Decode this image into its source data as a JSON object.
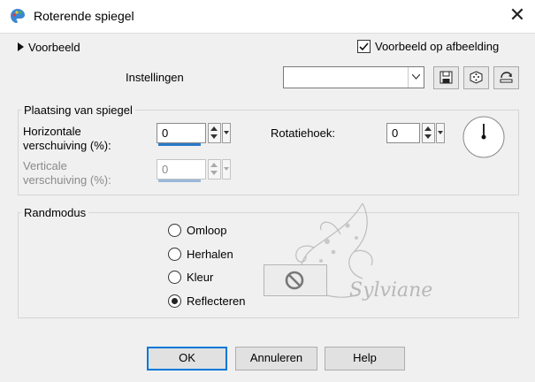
{
  "dialog": {
    "title": "Roterende spiegel",
    "close_glyph": "✕",
    "app_icon": "paint-palette-icon"
  },
  "preview": {
    "label": "Voorbeeld",
    "show_on_image_label": "Voorbeeld op afbeelding",
    "show_on_image_checked": true
  },
  "settings": {
    "label": "Instellingen",
    "preset_value": "",
    "tools": [
      "save-preset-icon",
      "randomize-dice-icon",
      "reset-icon"
    ]
  },
  "placement": {
    "title": "Plaatsing van spiegel",
    "horizontal": {
      "label_line1": "Horizontale",
      "label_line2": "verschuiving (%):",
      "value": "0"
    },
    "vertical": {
      "label_line1": "Verticale",
      "label_line2": "verschuiving (%):",
      "value": "0",
      "enabled": false
    },
    "rotation": {
      "label": "Rotatiehoek:",
      "value": "0"
    }
  },
  "edge_mode": {
    "title": "Randmodus",
    "options": [
      {
        "label": "Omloop",
        "selected": false
      },
      {
        "label": "Herhalen",
        "selected": false
      },
      {
        "label": "Kleur",
        "selected": false
      },
      {
        "label": "Reflecteren",
        "selected": true
      }
    ],
    "color_swatch_icon": "no-color-icon"
  },
  "watermark": {
    "signature": "Sylviane"
  },
  "buttons": {
    "ok": "OK",
    "cancel": "Annuleren",
    "help": "Help"
  },
  "colors": {
    "accent": "#0078d7",
    "bar": "#2a79c9",
    "background": "#f0f0f0"
  }
}
